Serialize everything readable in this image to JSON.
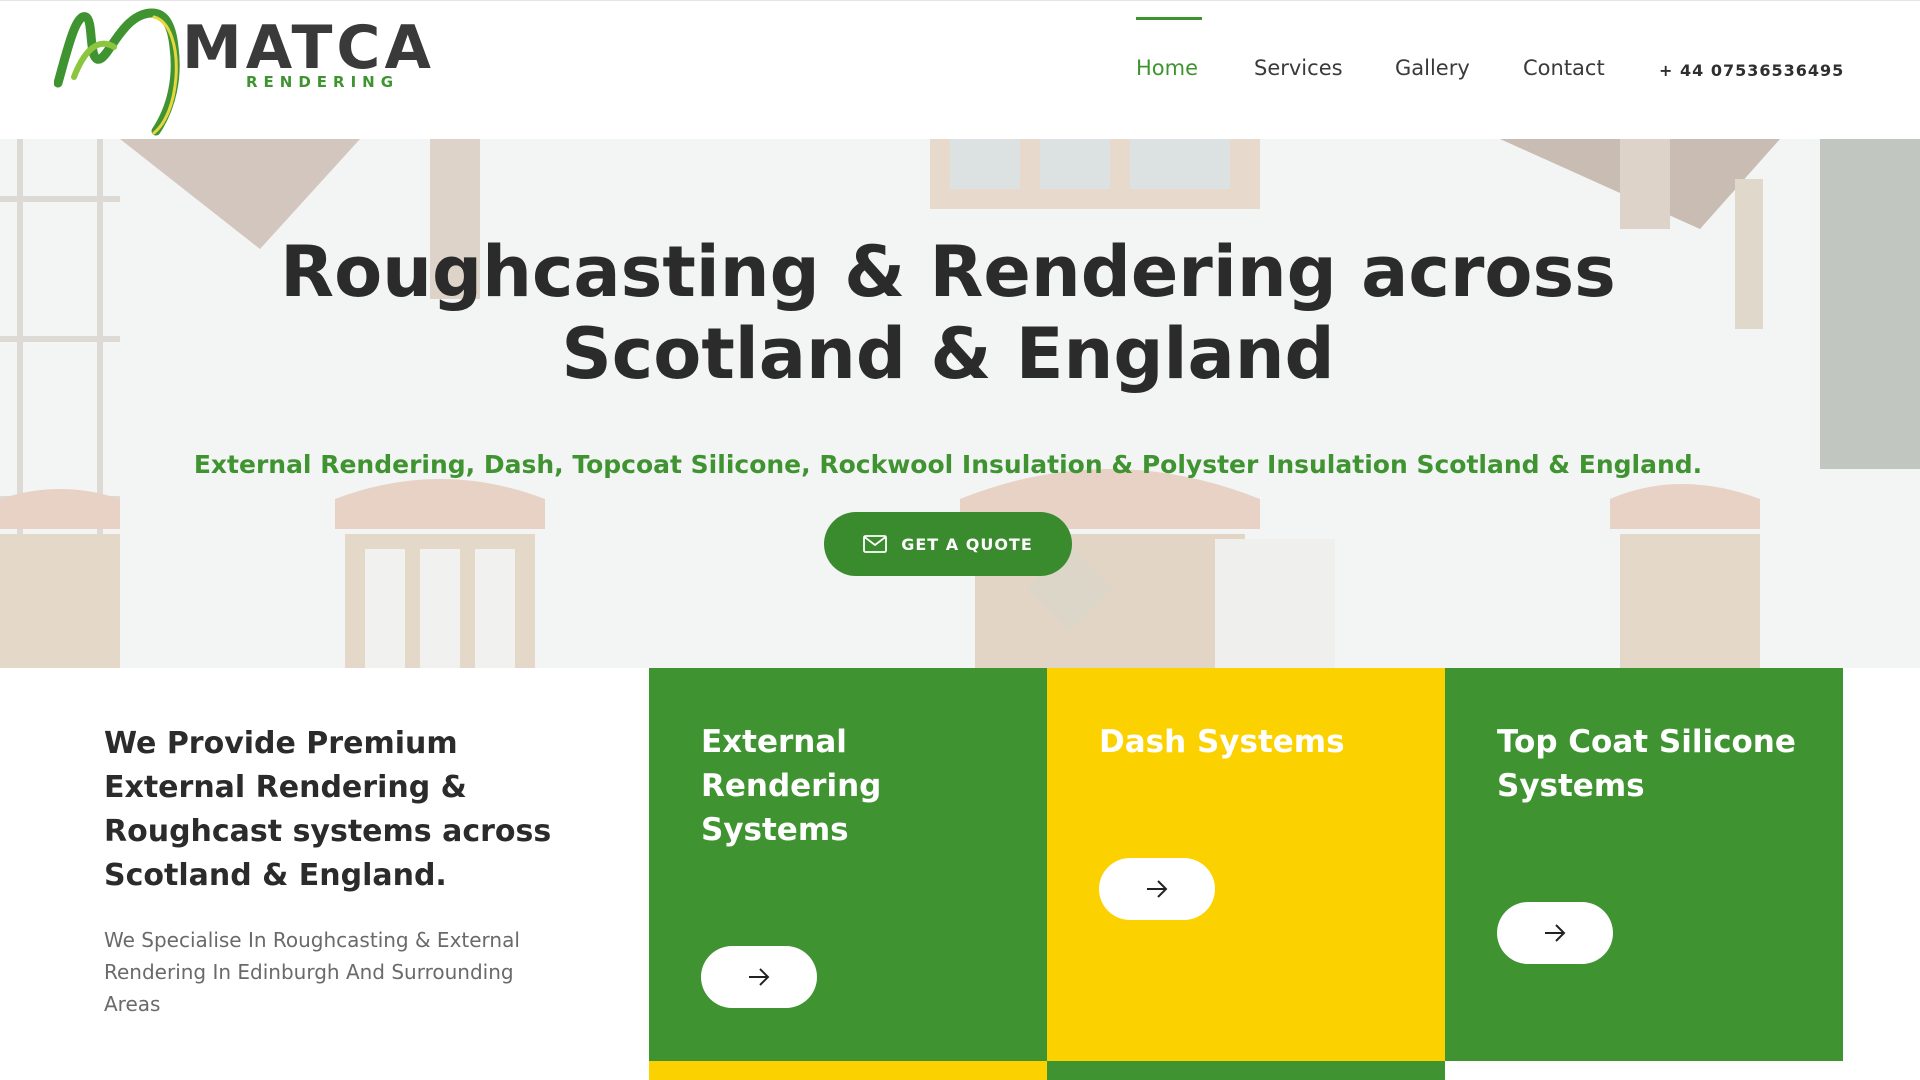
{
  "brand": {
    "name": "MATCA",
    "tagline": "RENDERING",
    "colors": {
      "green": "#3f9431",
      "yellow": "#fcd100",
      "dark": "#2b2b2b"
    }
  },
  "nav": {
    "items": [
      {
        "label": "Home",
        "active": true
      },
      {
        "label": "Services",
        "active": false
      },
      {
        "label": "Gallery",
        "active": false
      },
      {
        "label": "Contact",
        "active": false
      }
    ],
    "phone": "+ 44 07536536495"
  },
  "hero": {
    "title_line1": "Roughcasting & Rendering across",
    "title_line2": "Scotland & England",
    "subtitle": "External Rendering, Dash, Topcoat Silicone, Rockwool Insulation & Polyster Insulation Scotland & England.",
    "cta_label": "GET A QUOTE",
    "cta_icon": "envelope-icon"
  },
  "intro": {
    "title": "We Provide Premium External Rendering & Roughcast systems across Scotland & England.",
    "text": "We Specialise In Roughcasting & External Rendering In Edinburgh And Surrounding Areas"
  },
  "services": [
    {
      "title": "External Rendering Systems",
      "color": "green",
      "icon": "arrow-right-icon"
    },
    {
      "title": "Dash Systems",
      "color": "yellow",
      "icon": "arrow-right-icon"
    },
    {
      "title": "Top Coat Silicone Systems",
      "color": "green",
      "icon": "arrow-right-icon"
    }
  ]
}
